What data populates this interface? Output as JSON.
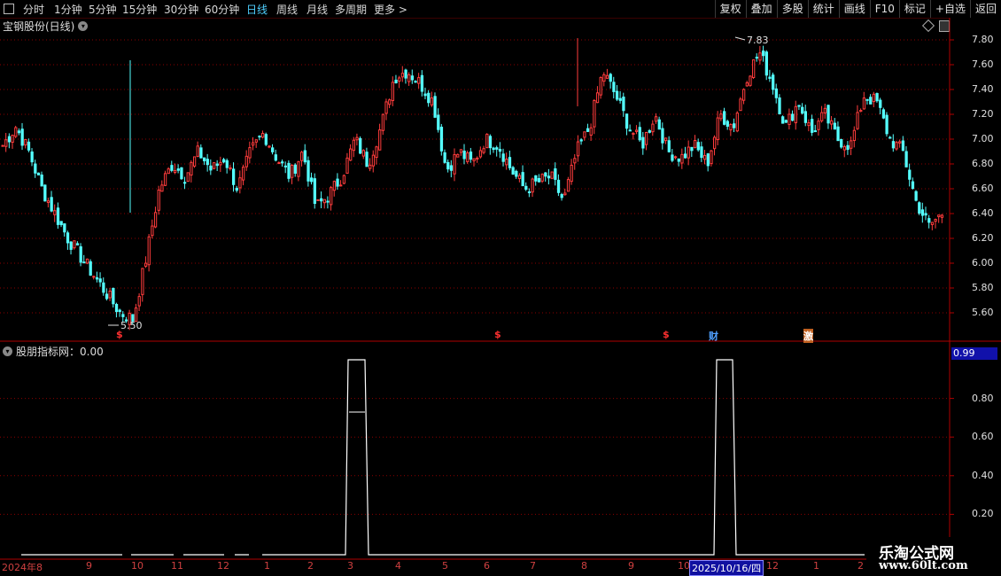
{
  "toolbar": {
    "periods": [
      "分时",
      "1分钟",
      "5分钟",
      "15分钟",
      "30分钟",
      "60分钟",
      "日线",
      "周线",
      "月线",
      "多周期",
      "更多 >"
    ],
    "active_period": "日线",
    "right_buttons": [
      "复权",
      "叠加",
      "多股",
      "统计",
      "画线",
      "F10",
      "标记",
      "+自选",
      "返回"
    ]
  },
  "main_chart": {
    "title": "宝钢股份(日线)",
    "y_ticks": [
      "7.80",
      "7.60",
      "7.40",
      "7.20",
      "7.00",
      "6.80",
      "6.60",
      "6.40",
      "6.20",
      "6.00",
      "5.80",
      "5.60"
    ],
    "y_values": [
      7.8,
      7.6,
      7.4,
      7.2,
      7.0,
      6.8,
      6.6,
      6.4,
      6.2,
      6.0,
      5.8,
      5.6
    ],
    "low_label": "5.50",
    "high_label": "7.83",
    "markers": [
      {
        "text": "$",
        "color": "#ff3030"
      },
      {
        "text": "$",
        "color": "#ff3030"
      },
      {
        "text": "$",
        "color": "#ff3030"
      },
      {
        "text": "财",
        "color": "#4fa0ff"
      },
      {
        "text": "激",
        "color": "#ff8030"
      }
    ]
  },
  "sub_chart": {
    "title": "股朋指标网：0.00",
    "y_ticks": [
      "0.80",
      "0.60",
      "0.40",
      "0.20"
    ],
    "value_box": "0.99"
  },
  "x_axis": {
    "labels": [
      "2024年8",
      "9",
      "10",
      "11",
      "12",
      "1",
      "2",
      "3",
      "4",
      "5",
      "6",
      "7",
      "8",
      "9",
      "10",
      "12",
      "1",
      "2"
    ],
    "highlight": "2025/10/16/四"
  },
  "watermark": {
    "line1": "乐淘公式网",
    "line2": "www.60lt.com"
  },
  "colors": {
    "up": "#ff3c3c",
    "down": "#54ffff",
    "grid": "#8b0000",
    "axis": "#b00000"
  },
  "chart_data": {
    "type": "candlestick",
    "title": "宝钢股份(日线)",
    "ylim": [
      5.5,
      7.85
    ],
    "series": [
      {
        "name": "close",
        "values": [
          6.95,
          7.1,
          6.9,
          6.6,
          6.4,
          6.2,
          6.05,
          5.9,
          5.75,
          5.6,
          5.55,
          6.05,
          6.6,
          6.8,
          6.7,
          6.9,
          6.75,
          6.85,
          6.6,
          6.9,
          7.05,
          6.85,
          6.7,
          6.9,
          6.45,
          6.55,
          6.7,
          7.0,
          6.8,
          7.1,
          7.5,
          7.55,
          7.45,
          7.3,
          6.75,
          6.9,
          6.8,
          7.0,
          6.95,
          6.75,
          6.6,
          6.65,
          6.7,
          6.5,
          6.9,
          7.1,
          7.55,
          7.35,
          7.1,
          6.95,
          7.2,
          6.9,
          6.85,
          6.95,
          6.8,
          7.2,
          7.1,
          7.5,
          7.7,
          7.45,
          7.1,
          7.3,
          7.05,
          7.2,
          7.0,
          6.95,
          7.35,
          7.3,
          7.0,
          6.9,
          6.5,
          6.3,
          6.4
        ]
      }
    ]
  }
}
